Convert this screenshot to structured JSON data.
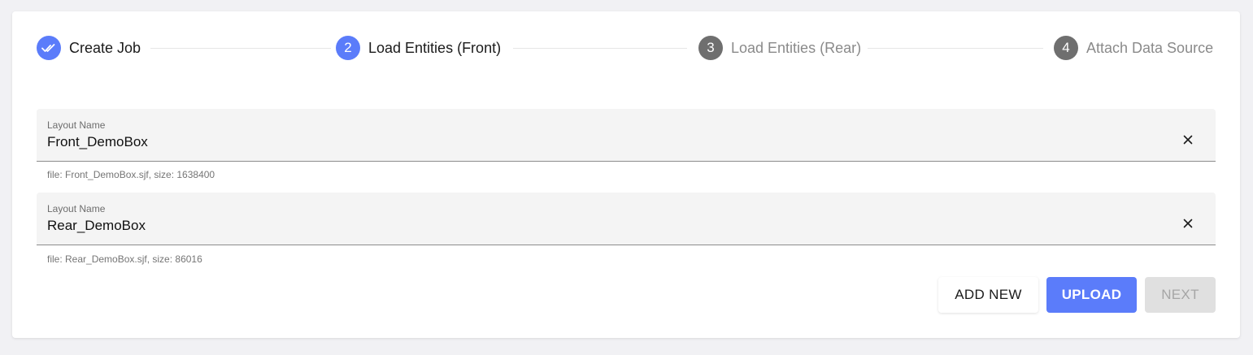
{
  "stepper": {
    "steps": [
      {
        "number": "",
        "label": "Create Job",
        "state": "completed",
        "icon": "double-check-icon"
      },
      {
        "number": "2",
        "label": "Load Entities (Front)",
        "state": "active"
      },
      {
        "number": "3",
        "label": "Load Entities (Rear)",
        "state": "pending"
      },
      {
        "number": "4",
        "label": "Attach Data Source",
        "state": "pending"
      }
    ]
  },
  "layouts": [
    {
      "label": "Layout Name",
      "value": "Front_DemoBox",
      "helper": "file: Front_DemoBox.sjf, size: 1638400"
    },
    {
      "label": "Layout Name",
      "value": "Rear_DemoBox",
      "helper": "file: Rear_DemoBox.sjf, size: 86016"
    }
  ],
  "actions": {
    "add_new": "ADD NEW",
    "upload": "UPLOAD",
    "next": "NEXT"
  },
  "colors": {
    "accent": "#5b7cfa",
    "pending_step": "#6f6f6f",
    "disabled_bg": "#e0e0e0"
  }
}
